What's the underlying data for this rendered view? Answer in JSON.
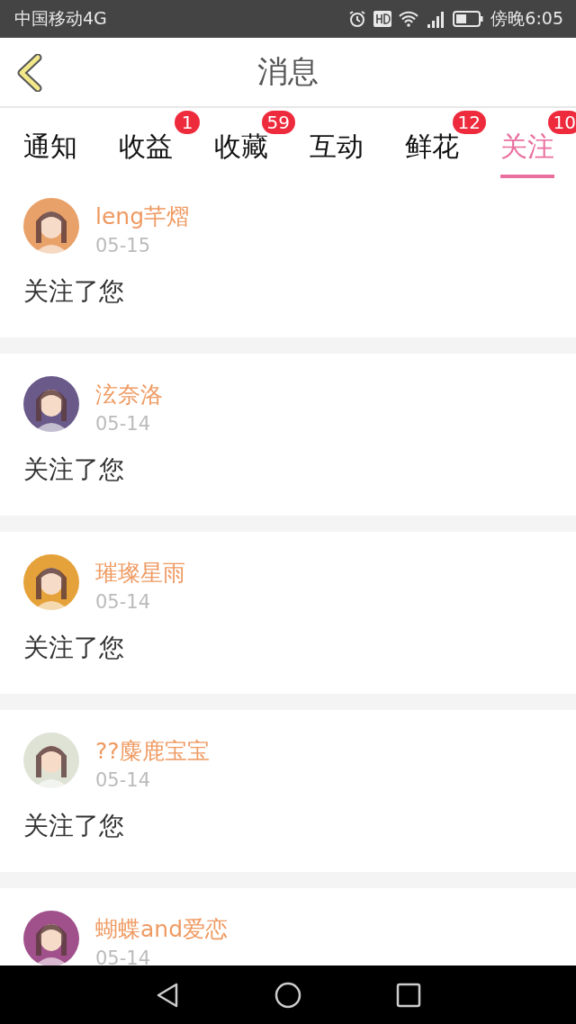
{
  "status_bar": {
    "carrier": "中国移动4G",
    "time": "傍晚6:05"
  },
  "header": {
    "title": "消息"
  },
  "tabs": [
    {
      "label": "通知",
      "selected": false
    },
    {
      "label": "收益",
      "badge": "1",
      "selected": false
    },
    {
      "label": "收藏",
      "badge": "59",
      "selected": false
    },
    {
      "label": "互动",
      "selected": false
    },
    {
      "label": "鲜花",
      "badge": "12",
      "selected": false
    },
    {
      "label": "关注",
      "badge": "10",
      "selected": true
    }
  ],
  "messages": [
    {
      "name": "leng芊熠",
      "date": "05-15",
      "text": "关注了您",
      "color": "#e9a16a"
    },
    {
      "name": "泫奈洛",
      "date": "05-14",
      "text": "关注了您",
      "color": "#6a5a8a"
    },
    {
      "name": "璀璨星雨",
      "date": "05-14",
      "text": "关注了您",
      "color": "#e6a23a"
    },
    {
      "name": "??麋鹿宝宝",
      "date": "05-14",
      "text": "关注了您",
      "color": "#dfe3d6"
    },
    {
      "name": "蝴蝶and爱恋",
      "date": "05-14",
      "color": "#a0508a"
    }
  ]
}
